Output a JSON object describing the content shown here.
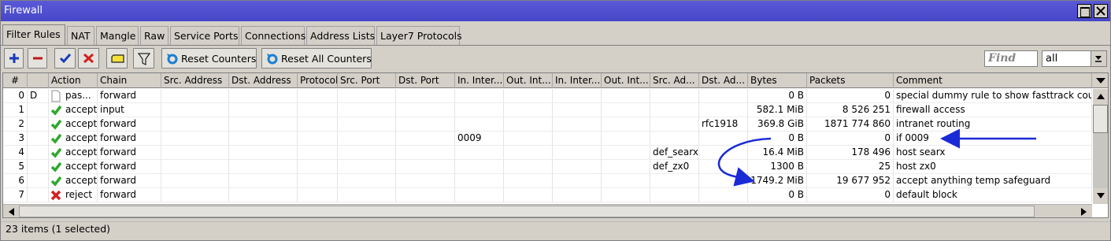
{
  "window": {
    "title": "Firewall"
  },
  "tabs": [
    "Filter Rules",
    "NAT",
    "Mangle",
    "Raw",
    "Service Ports",
    "Connections",
    "Address Lists",
    "Layer7 Protocols"
  ],
  "toolbar": {
    "reset_counters": "Reset Counters",
    "reset_all_counters": "Reset All Counters",
    "find_placeholder": "Find",
    "filter_value": "all"
  },
  "table": {
    "columns": [
      "#",
      "",
      "Action",
      "Chain",
      "Src. Address",
      "Dst. Address",
      "Protocol",
      "Src. Port",
      "Dst. Port",
      "In. Inter...",
      "Out. Int...",
      "In. Inter...",
      "Out. Int...",
      "Src. Ad...",
      "Dst. Ad...",
      "Bytes",
      "Packets",
      "Comment"
    ],
    "rows": [
      {
        "num": "0",
        "flag": "D",
        "icon": "doc",
        "action": "pas...",
        "chain": "forward",
        "in_iface": "",
        "src_list": "",
        "dst_list": "",
        "bytes": "0 B",
        "packets": "0",
        "comment": "special dummy rule to show fasttrack counters"
      },
      {
        "num": "1",
        "flag": "",
        "icon": "check",
        "action": "accept",
        "chain": "input",
        "in_iface": "",
        "src_list": "",
        "dst_list": "",
        "bytes": "582.1 MiB",
        "packets": "8 526 251",
        "comment": "firewall access"
      },
      {
        "num": "2",
        "flag": "",
        "icon": "check",
        "action": "accept",
        "chain": "forward",
        "in_iface": "",
        "src_list": "",
        "dst_list": "rfc1918",
        "bytes": "369.8 GiB",
        "packets": "1871 774 860",
        "comment": "intranet routing"
      },
      {
        "num": "3",
        "flag": "",
        "icon": "check",
        "action": "accept",
        "chain": "forward",
        "in_iface": "0009",
        "src_list": "",
        "dst_list": "",
        "bytes": "0 B",
        "packets": "0",
        "comment": "if 0009"
      },
      {
        "num": "4",
        "flag": "",
        "icon": "check",
        "action": "accept",
        "chain": "forward",
        "in_iface": "",
        "src_list": "def_searx",
        "dst_list": "",
        "bytes": "16.4 MiB",
        "packets": "178 496",
        "comment": "host searx"
      },
      {
        "num": "5",
        "flag": "",
        "icon": "check",
        "action": "accept",
        "chain": "forward",
        "in_iface": "",
        "src_list": "def_zx0",
        "dst_list": "",
        "bytes": "1300 B",
        "packets": "25",
        "comment": "host zx0"
      },
      {
        "num": "6",
        "flag": "",
        "icon": "check",
        "action": "accept",
        "chain": "forward",
        "in_iface": "",
        "src_list": "",
        "dst_list": "",
        "bytes": "1749.2 MiB",
        "packets": "19 677 952",
        "comment": "accept anything temp safeguard"
      },
      {
        "num": "7",
        "flag": "",
        "icon": "cross",
        "action": "reject",
        "chain": "forward",
        "in_iface": "",
        "src_list": "",
        "dst_list": "",
        "bytes": "0 B",
        "packets": "0",
        "comment": "default block"
      }
    ]
  },
  "status": {
    "text": "23 items (1 selected)"
  },
  "colors": {
    "titlebar": "#4646c8",
    "annotation_arrow": "#1a2bd6",
    "accept": "#2fa82f",
    "reject": "#d42020"
  }
}
